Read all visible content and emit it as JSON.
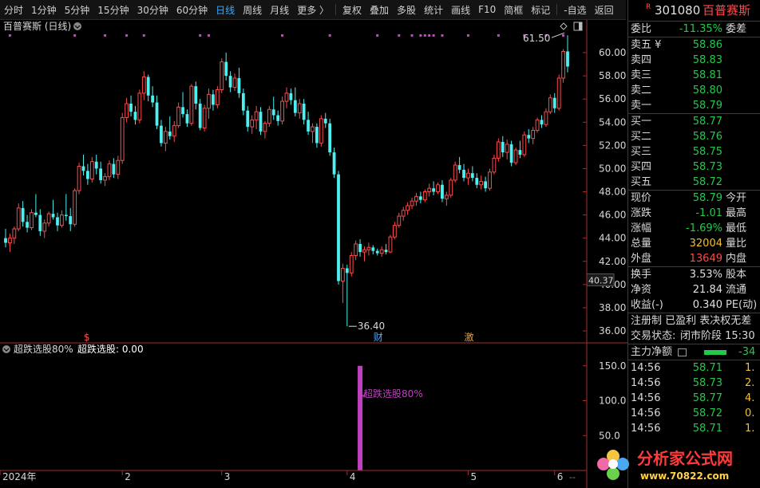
{
  "toolbar": {
    "items": [
      {
        "label": "分时",
        "active": false
      },
      {
        "label": "1分钟",
        "active": false
      },
      {
        "label": "5分钟",
        "active": false
      },
      {
        "label": "15分钟",
        "active": false
      },
      {
        "label": "30分钟",
        "active": false
      },
      {
        "label": "60分钟",
        "active": false
      },
      {
        "label": "日线",
        "active": true
      },
      {
        "label": "周线",
        "active": false
      },
      {
        "label": "月线",
        "active": false
      },
      {
        "label": "更多 〉",
        "active": false
      },
      {
        "label": "复权",
        "active": false
      },
      {
        "label": "叠加",
        "active": false
      },
      {
        "label": "多股",
        "active": false
      },
      {
        "label": "统计",
        "active": false
      },
      {
        "label": "画线",
        "active": false
      },
      {
        "label": "F10",
        "active": false
      },
      {
        "label": "简框",
        "active": false
      },
      {
        "label": "标记",
        "active": false
      },
      {
        "label": "-自选",
        "active": false
      },
      {
        "label": "返回",
        "active": false
      }
    ]
  },
  "main_chart": {
    "title": "百普赛斯 (日线)",
    "high_label": "61.50",
    "low_label": "36.40",
    "current_price_tag": "40.37",
    "markers": [
      "$",
      "财",
      "激"
    ]
  },
  "indicator": {
    "title": "超跌选股80%",
    "value_label": "超跌选股: 0.00",
    "signal_label": "超跌选股80%"
  },
  "chart_data": [
    {
      "type": "candlestick",
      "title": "百普赛斯 (日线)",
      "ylim": [
        35.6,
        61.9
      ],
      "yticks": [
        36,
        38,
        40,
        42,
        44,
        46,
        48,
        50,
        52,
        54,
        56,
        58,
        60
      ],
      "xtick_labels": [
        "2024年",
        "2",
        "3",
        "4",
        "5",
        "6"
      ],
      "xtick_index": [
        0,
        27,
        50,
        79,
        107,
        127
      ],
      "high": 61.5,
      "low": 36.4,
      "ohlc": [
        [
          44.0,
          44.8,
          43.2,
          43.6
        ],
        [
          43.6,
          44.4,
          42.8,
          44.0
        ],
        [
          44.0,
          45.0,
          43.5,
          44.8
        ],
        [
          44.8,
          47.0,
          44.6,
          46.6
        ],
        [
          46.6,
          47.2,
          45.0,
          45.4
        ],
        [
          45.4,
          46.0,
          44.5,
          44.9
        ],
        [
          44.9,
          46.5,
          44.7,
          46.2
        ],
        [
          46.2,
          47.8,
          45.8,
          46.0
        ],
        [
          46.0,
          46.5,
          44.2,
          44.6
        ],
        [
          44.6,
          45.6,
          44.0,
          45.3
        ],
        [
          45.3,
          46.3,
          45.0,
          46.1
        ],
        [
          46.1,
          47.3,
          45.6,
          45.8
        ],
        [
          45.8,
          46.2,
          44.6,
          45.1
        ],
        [
          45.1,
          46.4,
          44.9,
          46.0
        ],
        [
          46.0,
          47.8,
          45.5,
          45.9
        ],
        [
          45.9,
          46.6,
          44.6,
          45.2
        ],
        [
          45.2,
          48.3,
          45.0,
          48.1
        ],
        [
          48.1,
          50.5,
          47.8,
          50.2
        ],
        [
          50.2,
          51.2,
          49.4,
          49.8
        ],
        [
          49.8,
          50.4,
          48.6,
          49.1
        ],
        [
          49.1,
          51.0,
          48.8,
          50.6
        ],
        [
          50.6,
          51.2,
          49.5,
          50.0
        ],
        [
          50.0,
          50.6,
          48.7,
          49.0
        ],
        [
          49.0,
          49.6,
          48.5,
          49.3
        ],
        [
          49.3,
          50.7,
          49.0,
          50.4
        ],
        [
          50.4,
          50.9,
          49.2,
          49.5
        ],
        [
          49.5,
          51.1,
          49.1,
          50.7
        ],
        [
          50.7,
          54.8,
          50.4,
          54.4
        ],
        [
          54.4,
          56.1,
          54.0,
          55.6
        ],
        [
          55.6,
          56.3,
          54.5,
          54.9
        ],
        [
          54.9,
          55.4,
          53.8,
          54.2
        ],
        [
          54.2,
          56.8,
          53.9,
          56.5
        ],
        [
          56.5,
          58.4,
          55.9,
          57.9
        ],
        [
          57.9,
          58.1,
          55.8,
          56.3
        ],
        [
          56.3,
          57.1,
          55.3,
          55.7
        ],
        [
          55.7,
          56.3,
          53.4,
          53.7
        ],
        [
          53.7,
          54.2,
          51.9,
          52.2
        ],
        [
          52.2,
          53.6,
          51.5,
          53.2
        ],
        [
          53.2,
          54.5,
          52.5,
          52.8
        ],
        [
          52.8,
          54.1,
          52.3,
          53.7
        ],
        [
          53.7,
          55.7,
          53.5,
          55.3
        ],
        [
          55.3,
          56.6,
          54.4,
          54.7
        ],
        [
          54.7,
          55.1,
          53.6,
          53.9
        ],
        [
          53.9,
          57.3,
          53.7,
          57.1
        ],
        [
          57.1,
          57.5,
          55.1,
          55.6
        ],
        [
          55.6,
          56.0,
          53.3,
          53.5
        ],
        [
          53.5,
          55.5,
          53.2,
          55.2
        ],
        [
          55.2,
          56.9,
          54.3,
          56.4
        ],
        [
          56.4,
          56.8,
          55.0,
          55.5
        ],
        [
          55.5,
          57.1,
          55.2,
          56.8
        ],
        [
          56.8,
          59.5,
          56.5,
          59.2
        ],
        [
          59.2,
          60.0,
          57.6,
          58.0
        ],
        [
          58.0,
          58.4,
          56.6,
          57.0
        ],
        [
          57.0,
          58.2,
          56.7,
          57.8
        ],
        [
          57.8,
          58.7,
          56.1,
          56.5
        ],
        [
          56.5,
          56.9,
          54.6,
          55.0
        ],
        [
          55.0,
          55.4,
          53.2,
          53.6
        ],
        [
          53.6,
          54.6,
          53.0,
          54.2
        ],
        [
          54.2,
          55.4,
          53.4,
          54.9
        ],
        [
          54.9,
          55.3,
          52.9,
          53.2
        ],
        [
          53.2,
          54.1,
          52.6,
          53.9
        ],
        [
          53.9,
          55.4,
          53.6,
          55.1
        ],
        [
          55.1,
          56.2,
          54.2,
          54.6
        ],
        [
          54.6,
          55.0,
          53.7,
          54.1
        ],
        [
          54.1,
          56.2,
          53.8,
          55.8
        ],
        [
          55.8,
          57.0,
          55.2,
          56.5
        ],
        [
          56.5,
          56.9,
          55.5,
          55.9
        ],
        [
          55.9,
          57.0,
          54.5,
          54.8
        ],
        [
          54.8,
          56.0,
          54.3,
          55.6
        ],
        [
          55.6,
          56.0,
          53.8,
          54.2
        ],
        [
          54.2,
          54.9,
          52.9,
          53.2
        ],
        [
          53.2,
          53.9,
          52.2,
          53.6
        ],
        [
          53.6,
          53.9,
          51.8,
          52.2
        ],
        [
          52.2,
          54.6,
          51.9,
          54.3
        ],
        [
          54.3,
          54.8,
          53.5,
          53.9
        ],
        [
          53.9,
          54.3,
          51.1,
          51.4
        ],
        [
          51.4,
          51.8,
          49.2,
          49.5
        ],
        [
          49.5,
          49.8,
          40.0,
          40.3
        ],
        [
          40.3,
          41.8,
          38.4,
          41.4
        ],
        [
          41.4,
          41.7,
          36.4,
          41.0
        ],
        [
          41.0,
          42.8,
          40.7,
          42.5
        ],
        [
          42.5,
          43.8,
          42.1,
          43.5
        ],
        [
          43.5,
          43.9,
          42.4,
          42.8
        ],
        [
          42.8,
          43.3,
          42.0,
          43.0
        ],
        [
          43.0,
          43.6,
          42.5,
          43.2
        ],
        [
          43.2,
          43.4,
          42.6,
          42.9
        ],
        [
          42.9,
          43.1,
          42.5,
          42.7
        ],
        [
          42.7,
          43.3,
          42.4,
          43.0
        ],
        [
          43.0,
          43.5,
          42.6,
          42.8
        ],
        [
          42.8,
          44.3,
          42.7,
          44.1
        ],
        [
          44.1,
          45.4,
          43.9,
          45.1
        ],
        [
          45.1,
          46.2,
          44.9,
          45.9
        ],
        [
          45.9,
          46.7,
          45.5,
          46.4
        ],
        [
          46.4,
          47.1,
          46.0,
          46.8
        ],
        [
          46.8,
          47.5,
          46.5,
          47.2
        ],
        [
          47.2,
          47.9,
          46.8,
          47.6
        ],
        [
          47.6,
          48.0,
          47.0,
          47.3
        ],
        [
          47.3,
          48.2,
          47.1,
          48.0
        ],
        [
          48.0,
          48.7,
          47.6,
          48.3
        ],
        [
          48.3,
          48.9,
          47.7,
          48.0
        ],
        [
          48.0,
          48.8,
          47.8,
          48.6
        ],
        [
          48.6,
          49.0,
          47.1,
          47.4
        ],
        [
          47.4,
          48.0,
          46.8,
          47.7
        ],
        [
          47.7,
          49.2,
          47.5,
          49.0
        ],
        [
          49.0,
          50.6,
          48.8,
          50.3
        ],
        [
          50.3,
          51.0,
          49.6,
          49.9
        ],
        [
          49.9,
          50.4,
          48.9,
          49.2
        ],
        [
          49.2,
          50.0,
          48.6,
          49.6
        ],
        [
          49.6,
          50.2,
          48.9,
          49.2
        ],
        [
          49.2,
          49.6,
          48.3,
          48.6
        ],
        [
          48.6,
          49.4,
          48.2,
          48.9
        ],
        [
          48.9,
          49.3,
          48.0,
          48.3
        ],
        [
          48.3,
          50.0,
          48.1,
          49.7
        ],
        [
          49.7,
          51.2,
          49.5,
          50.9
        ],
        [
          50.9,
          52.6,
          50.6,
          52.3
        ],
        [
          52.3,
          52.8,
          51.0,
          51.4
        ],
        [
          51.4,
          52.5,
          50.8,
          52.1
        ],
        [
          52.1,
          52.4,
          50.2,
          50.5
        ],
        [
          50.5,
          51.8,
          50.3,
          51.6
        ],
        [
          51.6,
          52.4,
          50.9,
          51.2
        ],
        [
          51.2,
          53.2,
          51.0,
          52.9
        ],
        [
          52.9,
          53.4,
          52.2,
          52.6
        ],
        [
          52.6,
          53.6,
          52.1,
          53.3
        ],
        [
          53.3,
          54.4,
          53.1,
          54.2
        ],
        [
          54.2,
          54.6,
          53.5,
          53.8
        ],
        [
          53.8,
          55.2,
          53.6,
          54.9
        ],
        [
          54.9,
          56.4,
          54.7,
          56.1
        ],
        [
          56.1,
          56.5,
          54.8,
          55.2
        ],
        [
          55.2,
          58.1,
          55.0,
          57.8
        ],
        [
          57.8,
          60.3,
          57.4,
          60.1
        ],
        [
          60.1,
          61.5,
          58.3,
          58.8
        ]
      ]
    },
    {
      "type": "bar",
      "title": "超跌选股80%",
      "ylim": [
        0,
        160
      ],
      "yticks": [
        50.0,
        100.0,
        150.0
      ],
      "signal_index": 82,
      "signal_value": 150.0,
      "value": 0.0
    }
  ],
  "quote": {
    "code": "301080",
    "name": "百普赛斯",
    "badge": "R",
    "webi": {
      "label": "委比",
      "value": "-11.35%",
      "label2": "委差"
    },
    "sell": [
      {
        "label": "卖五 ¥",
        "price": "58.86"
      },
      {
        "label": "卖四",
        "price": "58.83"
      },
      {
        "label": "卖三",
        "price": "58.81"
      },
      {
        "label": "卖二",
        "price": "58.80"
      },
      {
        "label": "卖一",
        "price": "58.79"
      }
    ],
    "buy": [
      {
        "label": "买一",
        "price": "58.77"
      },
      {
        "label": "买二",
        "price": "58.76"
      },
      {
        "label": "买三",
        "price": "58.75"
      },
      {
        "label": "买四",
        "price": "58.73"
      },
      {
        "label": "买五",
        "price": "58.72"
      }
    ],
    "stats1": [
      {
        "label": "现价",
        "value": "58.79",
        "color": "green",
        "label2": "今开"
      },
      {
        "label": "涨跌",
        "value": "-1.01",
        "color": "green",
        "label2": "最高"
      },
      {
        "label": "涨幅",
        "value": "-1.69%",
        "color": "green",
        "label2": "最低"
      },
      {
        "label": "总量",
        "value": "32004",
        "color": "yellow",
        "label2": "量比"
      },
      {
        "label": "外盘",
        "value": "13649",
        "color": "red",
        "label2": "内盘"
      }
    ],
    "stats2": [
      {
        "label": "换手",
        "value": "3.53%",
        "color": "white",
        "label2": "股本"
      },
      {
        "label": "净资",
        "value": "21.84",
        "color": "white",
        "label2": "流通"
      },
      {
        "label": "收益(-)",
        "value": "0.340",
        "color": "white",
        "label2": "PE(动)"
      }
    ],
    "info_line": "注册制 已盈利 表决权无差",
    "trade_status_label": "交易状态:",
    "trade_status_value": "闭市阶段 15:30",
    "main_flow_label": "主力净额",
    "main_flow_value": "-34",
    "ticks": [
      {
        "time": "14:56",
        "price": "58.71",
        "vol": "1."
      },
      {
        "time": "14:56",
        "price": "58.73",
        "vol": "2."
      },
      {
        "time": "14:56",
        "price": "58.77",
        "vol": "4."
      },
      {
        "time": "14:56",
        "price": "58.72",
        "vol": "0."
      },
      {
        "time": "14:56",
        "price": "58.71",
        "vol": "1."
      }
    ]
  },
  "logo": {
    "text": "分析家公式网",
    "url_text": "www.70822.com"
  },
  "colors": {
    "up": "#ff4a4a",
    "down": "#4cf0f0",
    "signal": "#c040c0",
    "text_green": "#24c84b"
  }
}
